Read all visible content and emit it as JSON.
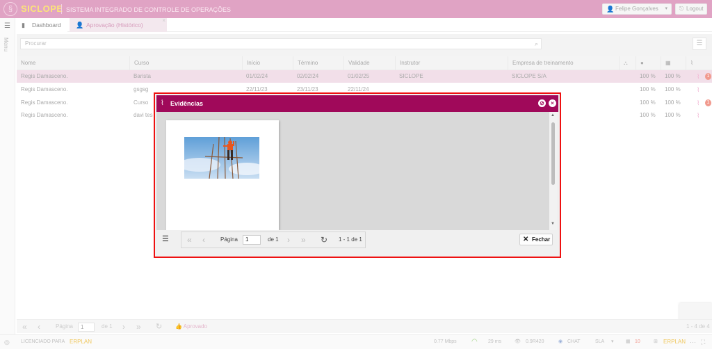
{
  "app": {
    "brand": "SICLOPE",
    "system_title": "SISTEMA INTEGRADO DE CONTROLE DE OPERAÇÕES",
    "user_name": "Felipe Gonçalves",
    "logout_label": "Logout",
    "menu_label": "Menu"
  },
  "tabs": [
    {
      "label": "Dashboard"
    },
    {
      "label": "Aprovação (Histórico)"
    }
  ],
  "search": {
    "placeholder": "Procurar"
  },
  "table": {
    "headers": [
      "Nome",
      "Curso",
      "Início",
      "Término",
      "Validade",
      "Instrutor",
      "Empresa de treinamento"
    ],
    "rows": [
      {
        "nome": "Regis Damasceno.",
        "curso": "Barista",
        "inicio": "01/02/24",
        "termino": "02/02/24",
        "validade": "01/02/25",
        "instrutor": "SICLOPE",
        "empresa": "SICLOPE S/A",
        "p1": "100 %",
        "p2": "100 %",
        "badge": "1"
      },
      {
        "nome": "Regis Damasceno.",
        "curso": "gsgsg",
        "inicio": "22/11/23",
        "termino": "23/11/23",
        "validade": "22/11/24",
        "instrutor": "",
        "empresa": "",
        "p1": "100 %",
        "p2": "100 %",
        "badge": ""
      },
      {
        "nome": "Regis Damasceno.",
        "curso": "Curso",
        "inicio": "",
        "termino": "",
        "validade": "",
        "instrutor": "",
        "empresa": "",
        "p1": "100 %",
        "p2": "100 %",
        "badge": "1"
      },
      {
        "nome": "Regis Damasceno.",
        "curso": "davi tes",
        "inicio": "",
        "termino": "",
        "validade": "",
        "instrutor": "",
        "empresa": "",
        "p1": "100 %",
        "p2": "100 %",
        "badge": ""
      }
    ]
  },
  "pager": {
    "page_label": "Página",
    "page_value": "1",
    "of_label": "de 1",
    "approve_label": "Aprovado",
    "range_label": "1 - 4 de 4"
  },
  "status": {
    "licensed": "LICENCIADO PARA",
    "erplan_a": "ERPLAN",
    "speed": "0.77 Mbps",
    "ms": "29 ms",
    "version": "0.9R420",
    "chat": "CHAT",
    "sla": "SLA",
    "notif": "10",
    "erplan_b": "ERPLAN"
  },
  "modal": {
    "title": "Evidências",
    "page_label": "Página",
    "page_value": "1",
    "of_label": "de 1",
    "range_label": "1 - 1 de 1",
    "close_label": "Fechar"
  },
  "colors": {
    "accent": "#a0095a",
    "topbar": "#e0a3c4",
    "highlight_border": "#ee1111"
  }
}
